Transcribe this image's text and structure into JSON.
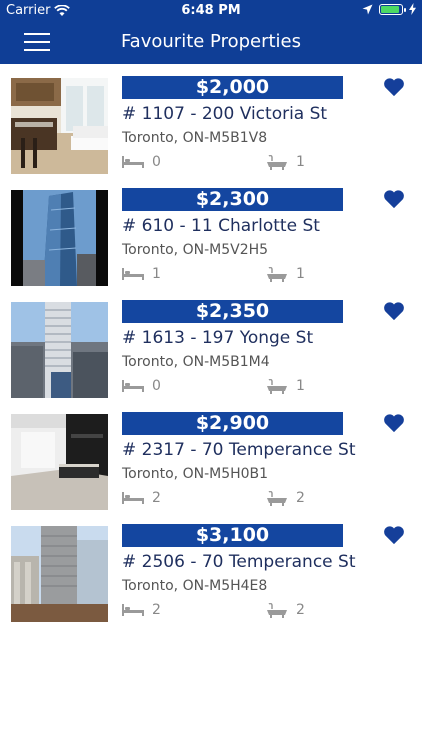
{
  "status_bar": {
    "carrier": "Carrier",
    "time": "6:48 PM"
  },
  "header": {
    "title": "Favourite Properties",
    "menu_icon": "hamburger-menu-icon",
    "color": "#0f3e96"
  },
  "accent_color": "#1446a0",
  "listings": [
    {
      "price": "$2,000",
      "address": "# 1107 - 200 Victoria St",
      "city": "Toronto, ON-M5B1V8",
      "beds": "0",
      "baths": "1"
    },
    {
      "price": "$2,300",
      "address": "# 610 - 11 Charlotte St",
      "city": "Toronto, ON-M5V2H5",
      "beds": "1",
      "baths": "1"
    },
    {
      "price": "$2,350",
      "address": "# 1613 - 197 Yonge St",
      "city": "Toronto, ON-M5B1M4",
      "beds": "0",
      "baths": "1"
    },
    {
      "price": "$2,900",
      "address": "# 2317 - 70 Temperance St",
      "city": "Toronto, ON-M5H0B1",
      "beds": "2",
      "baths": "2"
    },
    {
      "price": "$3,100",
      "address": "# 2506 - 70 Temperance St",
      "city": "Toronto, ON-M5H4E8",
      "beds": "2",
      "baths": "2"
    }
  ]
}
